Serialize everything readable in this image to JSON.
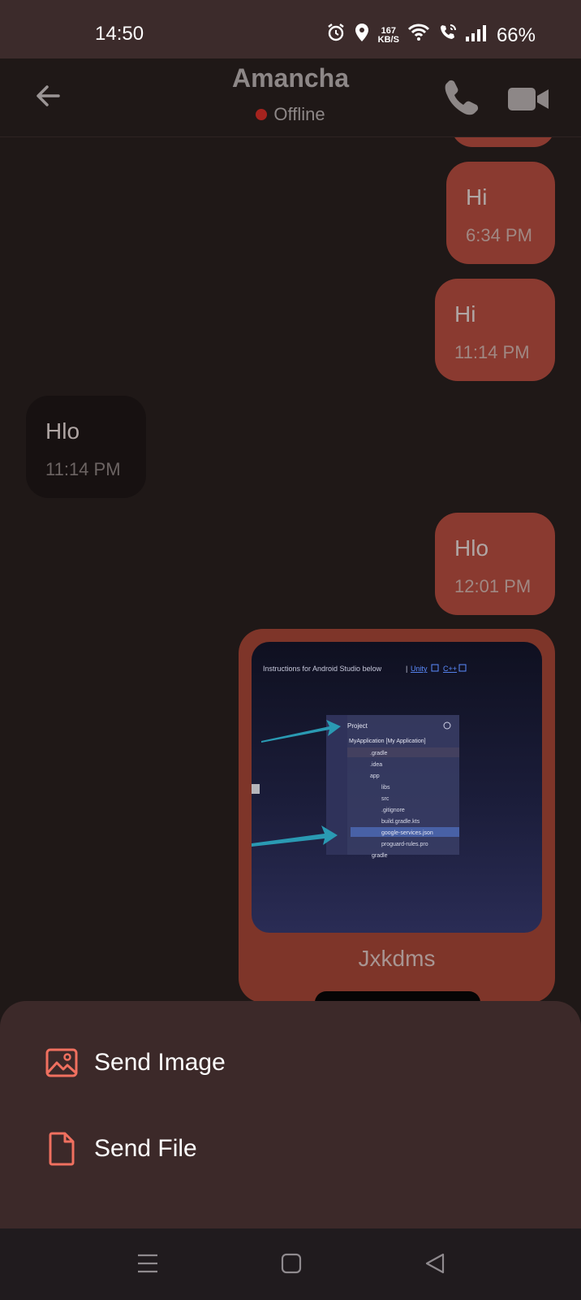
{
  "status_bar": {
    "time": "14:50",
    "net_speed_value": "167",
    "net_speed_unit": "KB/S",
    "battery": "66%"
  },
  "header": {
    "contact_name": "Amancha",
    "presence": "Offline",
    "presence_color": "#a5231e"
  },
  "messages": [
    {
      "direction": "out",
      "text": "Hi",
      "time": "6:34 PM"
    },
    {
      "direction": "out",
      "text": "Hi",
      "time": "11:14 PM"
    },
    {
      "direction": "in",
      "text": "Hlo",
      "time": "11:14 PM"
    },
    {
      "direction": "out",
      "text": "Hlo",
      "time": "12:01 PM"
    }
  ],
  "image_message": {
    "caption": "Jxkdms",
    "screenshot_text": {
      "instructions": "Instructions for Android Studio below",
      "link_unity": "Unity",
      "link_cpp": "C++",
      "panel_title": "Project",
      "tree": [
        "MyApplication [My Application]",
        ".gradle",
        ".idea",
        "app",
        "libs",
        "src",
        ".gitignore",
        "build.gradle.kts",
        "google-services.json",
        "proguard-rules.pro",
        "gradle"
      ]
    }
  },
  "sheet": {
    "send_image": "Send Image",
    "send_file": "Send File"
  },
  "colors": {
    "outgoing_bubble": "#8a3a30",
    "incoming_bubble": "#171111",
    "accent_icon": "#f0705f"
  }
}
